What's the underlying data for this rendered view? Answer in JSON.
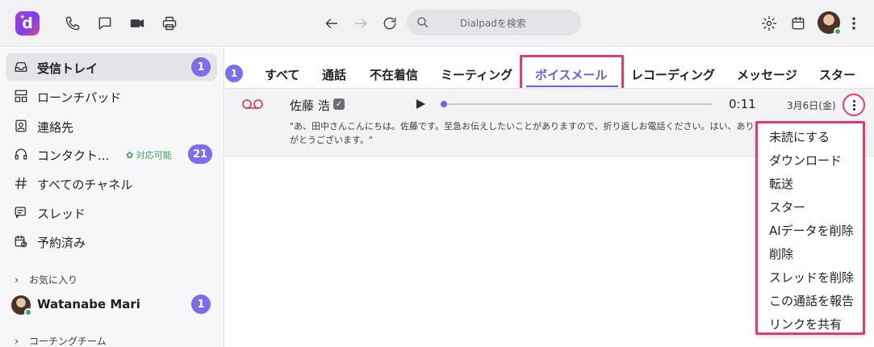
{
  "app": {
    "logo_letter": "d"
  },
  "topbar": {
    "icons": [
      "phone-icon",
      "chat-icon",
      "video-icon",
      "printer-icon",
      "back-arrow-icon",
      "forward-arrow-icon",
      "refresh-icon",
      "settings-icon",
      "calendar-icon",
      "more-vertical-icon"
    ],
    "search_placeholder": "Dialpadを検索"
  },
  "sidebar": {
    "items": [
      {
        "label": "受信トレイ",
        "icon": "inbox-icon",
        "badge": "1",
        "active": true
      },
      {
        "label": "ローンチパッド",
        "icon": "launchpad-icon"
      },
      {
        "label": "連絡先",
        "icon": "contacts-icon"
      },
      {
        "label": "コンタクト...",
        "icon": "headset-icon",
        "status": "対応可能",
        "badge": "21"
      },
      {
        "label": "すべてのチャネル",
        "icon": "hash-icon"
      },
      {
        "label": "スレッド",
        "icon": "thread-icon"
      },
      {
        "label": "予約済み",
        "icon": "scheduled-icon"
      }
    ],
    "favorites_header": "お気に入り",
    "favorite": {
      "name": "Watanabe Mari",
      "badge": "1"
    },
    "team_header": "コーチングチーム"
  },
  "tabs": {
    "count": "1",
    "items": [
      "すべて",
      "通話",
      "不在着信",
      "ミーティング",
      "ボイスメール",
      "レコーディング",
      "メッセージ",
      "スター"
    ],
    "active_index": 4
  },
  "voicemail": {
    "caller": "佐藤 浩",
    "duration": "0:11",
    "date": "3月6日(金)",
    "progress": 0,
    "transcript": "\"あ、田中さんこんにちは。佐藤です。至急お伝えしたいことがありますので、折り返しお電話ください。はい、ありがとうございます。\""
  },
  "context_menu": {
    "items": [
      "未読にする",
      "ダウンロード",
      "転送",
      "スター",
      "AIデータを削除",
      "削除",
      "スレッドを削除",
      "この通話を報告",
      "リンクを共有"
    ]
  },
  "colors": {
    "accent": "#6c5ce7",
    "highlight": "#e23b7a",
    "voicemail": "#d6344d",
    "available": "#3aa15b"
  }
}
